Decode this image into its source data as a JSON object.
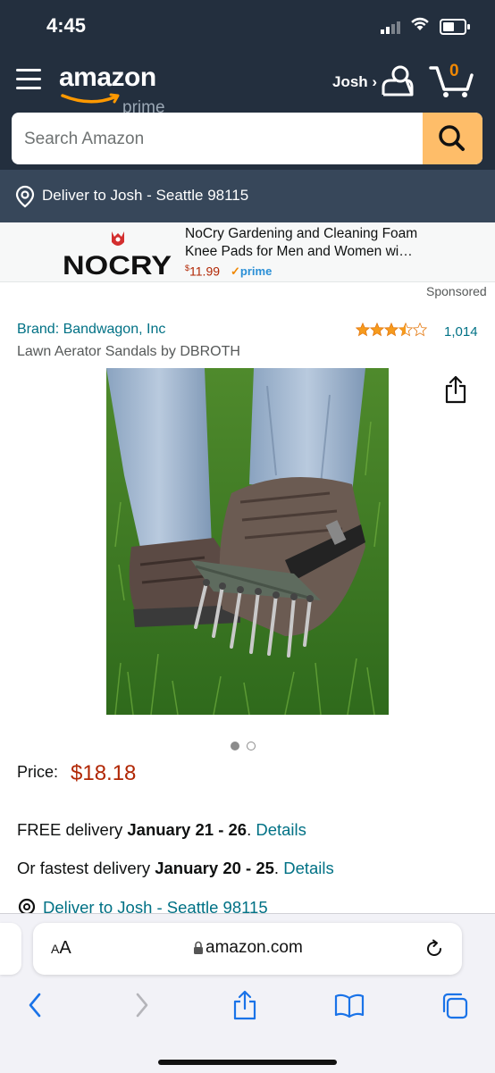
{
  "status_bar": {
    "time": "4:45",
    "battery_level": 0.45
  },
  "header": {
    "logo_text": "amazon",
    "logo_sub": "prime",
    "user_label": "Josh ›",
    "cart_count": "0",
    "search": {
      "placeholder": "Search Amazon"
    },
    "deliver_to": "Deliver to Josh - Seattle 98115"
  },
  "colors": {
    "header_bg": "#232f3e",
    "deliver_bar_bg": "#37475a",
    "search_button": "#febd69",
    "link": "#007185",
    "price": "#b12704",
    "star": "#f69b1d"
  },
  "sponsored_ad": {
    "brand_logo_text": "NOCRY",
    "title": "NoCry Gardening and Cleaning Foam Knee Pads for Men and Women wi…",
    "price_symbol": "$",
    "price": "11.99",
    "prime_label": "prime",
    "sponsored_label": "Sponsored"
  },
  "product": {
    "brand": "Brand: Bandwagon, Inc",
    "rating": 3.5,
    "rating_count": "1,014",
    "title": "Lawn Aerator Sandals by DBROTH",
    "image_count": 2,
    "current_image": 1,
    "price_label": "Price:",
    "price": "$18.18"
  },
  "delivery": {
    "free_prefix": "FREE delivery ",
    "free_dates": "January 21 - 26",
    "free_suffix": ". ",
    "details_label": "Details",
    "fast_prefix": "Or fastest delivery ",
    "fast_dates": "January 20 - 25",
    "fast_suffix": ". ",
    "deliver_to": "Deliver to Josh - Seattle 98115"
  },
  "browser": {
    "text_size_label_small": "A",
    "text_size_label_large": "A",
    "url": "amazon.com",
    "toolbar_icons": [
      "back-icon",
      "forward-icon",
      "share-icon",
      "bookmarks-icon",
      "tabs-icon"
    ]
  }
}
